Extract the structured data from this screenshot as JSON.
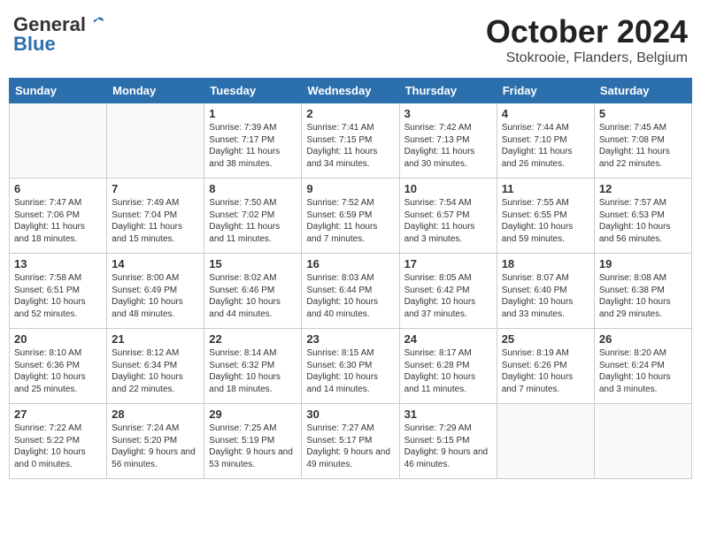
{
  "header": {
    "logo_general": "General",
    "logo_blue": "Blue",
    "month": "October 2024",
    "location": "Stokrooie, Flanders, Belgium"
  },
  "days_of_week": [
    "Sunday",
    "Monday",
    "Tuesday",
    "Wednesday",
    "Thursday",
    "Friday",
    "Saturday"
  ],
  "weeks": [
    [
      {
        "day": "",
        "info": ""
      },
      {
        "day": "",
        "info": ""
      },
      {
        "day": "1",
        "info": "Sunrise: 7:39 AM\nSunset: 7:17 PM\nDaylight: 11 hours and 38 minutes."
      },
      {
        "day": "2",
        "info": "Sunrise: 7:41 AM\nSunset: 7:15 PM\nDaylight: 11 hours and 34 minutes."
      },
      {
        "day": "3",
        "info": "Sunrise: 7:42 AM\nSunset: 7:13 PM\nDaylight: 11 hours and 30 minutes."
      },
      {
        "day": "4",
        "info": "Sunrise: 7:44 AM\nSunset: 7:10 PM\nDaylight: 11 hours and 26 minutes."
      },
      {
        "day": "5",
        "info": "Sunrise: 7:45 AM\nSunset: 7:08 PM\nDaylight: 11 hours and 22 minutes."
      }
    ],
    [
      {
        "day": "6",
        "info": "Sunrise: 7:47 AM\nSunset: 7:06 PM\nDaylight: 11 hours and 18 minutes."
      },
      {
        "day": "7",
        "info": "Sunrise: 7:49 AM\nSunset: 7:04 PM\nDaylight: 11 hours and 15 minutes."
      },
      {
        "day": "8",
        "info": "Sunrise: 7:50 AM\nSunset: 7:02 PM\nDaylight: 11 hours and 11 minutes."
      },
      {
        "day": "9",
        "info": "Sunrise: 7:52 AM\nSunset: 6:59 PM\nDaylight: 11 hours and 7 minutes."
      },
      {
        "day": "10",
        "info": "Sunrise: 7:54 AM\nSunset: 6:57 PM\nDaylight: 11 hours and 3 minutes."
      },
      {
        "day": "11",
        "info": "Sunrise: 7:55 AM\nSunset: 6:55 PM\nDaylight: 10 hours and 59 minutes."
      },
      {
        "day": "12",
        "info": "Sunrise: 7:57 AM\nSunset: 6:53 PM\nDaylight: 10 hours and 56 minutes."
      }
    ],
    [
      {
        "day": "13",
        "info": "Sunrise: 7:58 AM\nSunset: 6:51 PM\nDaylight: 10 hours and 52 minutes."
      },
      {
        "day": "14",
        "info": "Sunrise: 8:00 AM\nSunset: 6:49 PM\nDaylight: 10 hours and 48 minutes."
      },
      {
        "day": "15",
        "info": "Sunrise: 8:02 AM\nSunset: 6:46 PM\nDaylight: 10 hours and 44 minutes."
      },
      {
        "day": "16",
        "info": "Sunrise: 8:03 AM\nSunset: 6:44 PM\nDaylight: 10 hours and 40 minutes."
      },
      {
        "day": "17",
        "info": "Sunrise: 8:05 AM\nSunset: 6:42 PM\nDaylight: 10 hours and 37 minutes."
      },
      {
        "day": "18",
        "info": "Sunrise: 8:07 AM\nSunset: 6:40 PM\nDaylight: 10 hours and 33 minutes."
      },
      {
        "day": "19",
        "info": "Sunrise: 8:08 AM\nSunset: 6:38 PM\nDaylight: 10 hours and 29 minutes."
      }
    ],
    [
      {
        "day": "20",
        "info": "Sunrise: 8:10 AM\nSunset: 6:36 PM\nDaylight: 10 hours and 25 minutes."
      },
      {
        "day": "21",
        "info": "Sunrise: 8:12 AM\nSunset: 6:34 PM\nDaylight: 10 hours and 22 minutes."
      },
      {
        "day": "22",
        "info": "Sunrise: 8:14 AM\nSunset: 6:32 PM\nDaylight: 10 hours and 18 minutes."
      },
      {
        "day": "23",
        "info": "Sunrise: 8:15 AM\nSunset: 6:30 PM\nDaylight: 10 hours and 14 minutes."
      },
      {
        "day": "24",
        "info": "Sunrise: 8:17 AM\nSunset: 6:28 PM\nDaylight: 10 hours and 11 minutes."
      },
      {
        "day": "25",
        "info": "Sunrise: 8:19 AM\nSunset: 6:26 PM\nDaylight: 10 hours and 7 minutes."
      },
      {
        "day": "26",
        "info": "Sunrise: 8:20 AM\nSunset: 6:24 PM\nDaylight: 10 hours and 3 minutes."
      }
    ],
    [
      {
        "day": "27",
        "info": "Sunrise: 7:22 AM\nSunset: 5:22 PM\nDaylight: 10 hours and 0 minutes."
      },
      {
        "day": "28",
        "info": "Sunrise: 7:24 AM\nSunset: 5:20 PM\nDaylight: 9 hours and 56 minutes."
      },
      {
        "day": "29",
        "info": "Sunrise: 7:25 AM\nSunset: 5:19 PM\nDaylight: 9 hours and 53 minutes."
      },
      {
        "day": "30",
        "info": "Sunrise: 7:27 AM\nSunset: 5:17 PM\nDaylight: 9 hours and 49 minutes."
      },
      {
        "day": "31",
        "info": "Sunrise: 7:29 AM\nSunset: 5:15 PM\nDaylight: 9 hours and 46 minutes."
      },
      {
        "day": "",
        "info": ""
      },
      {
        "day": "",
        "info": ""
      }
    ]
  ]
}
